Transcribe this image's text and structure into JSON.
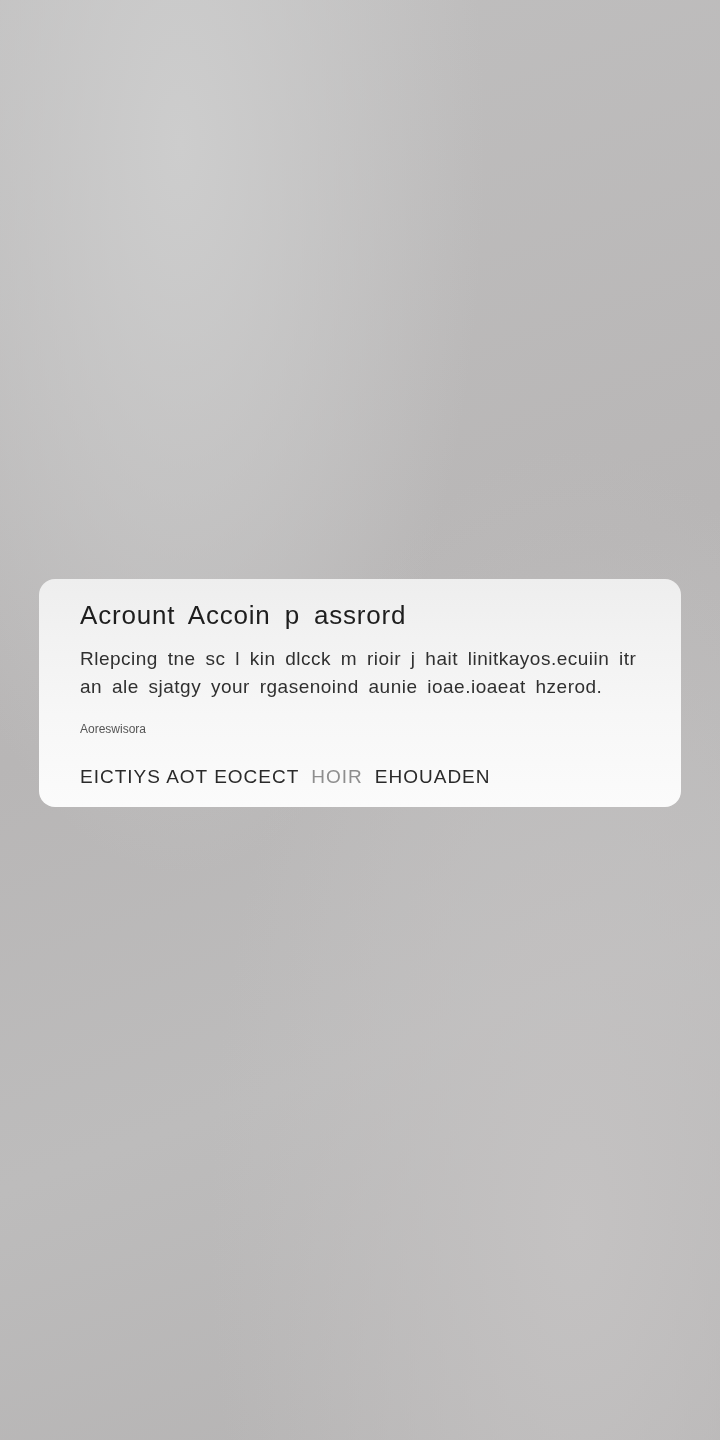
{
  "dialog": {
    "title": "Acrount Accoin p assrord",
    "message": "Rlepcing tne sc l kin dlcck m rioir j hait linitkayos.ecuiin itr an ale sjatgy your rgasenoind aunie ioae.ioaeat hzerod.",
    "field_label": "Aoreswisora",
    "actions": [
      {
        "label": "EICTIYS AOT EOCECT",
        "disabled": false
      },
      {
        "label": "HOIR",
        "disabled": true
      },
      {
        "label": "EHOUADEN",
        "disabled": false
      }
    ]
  }
}
